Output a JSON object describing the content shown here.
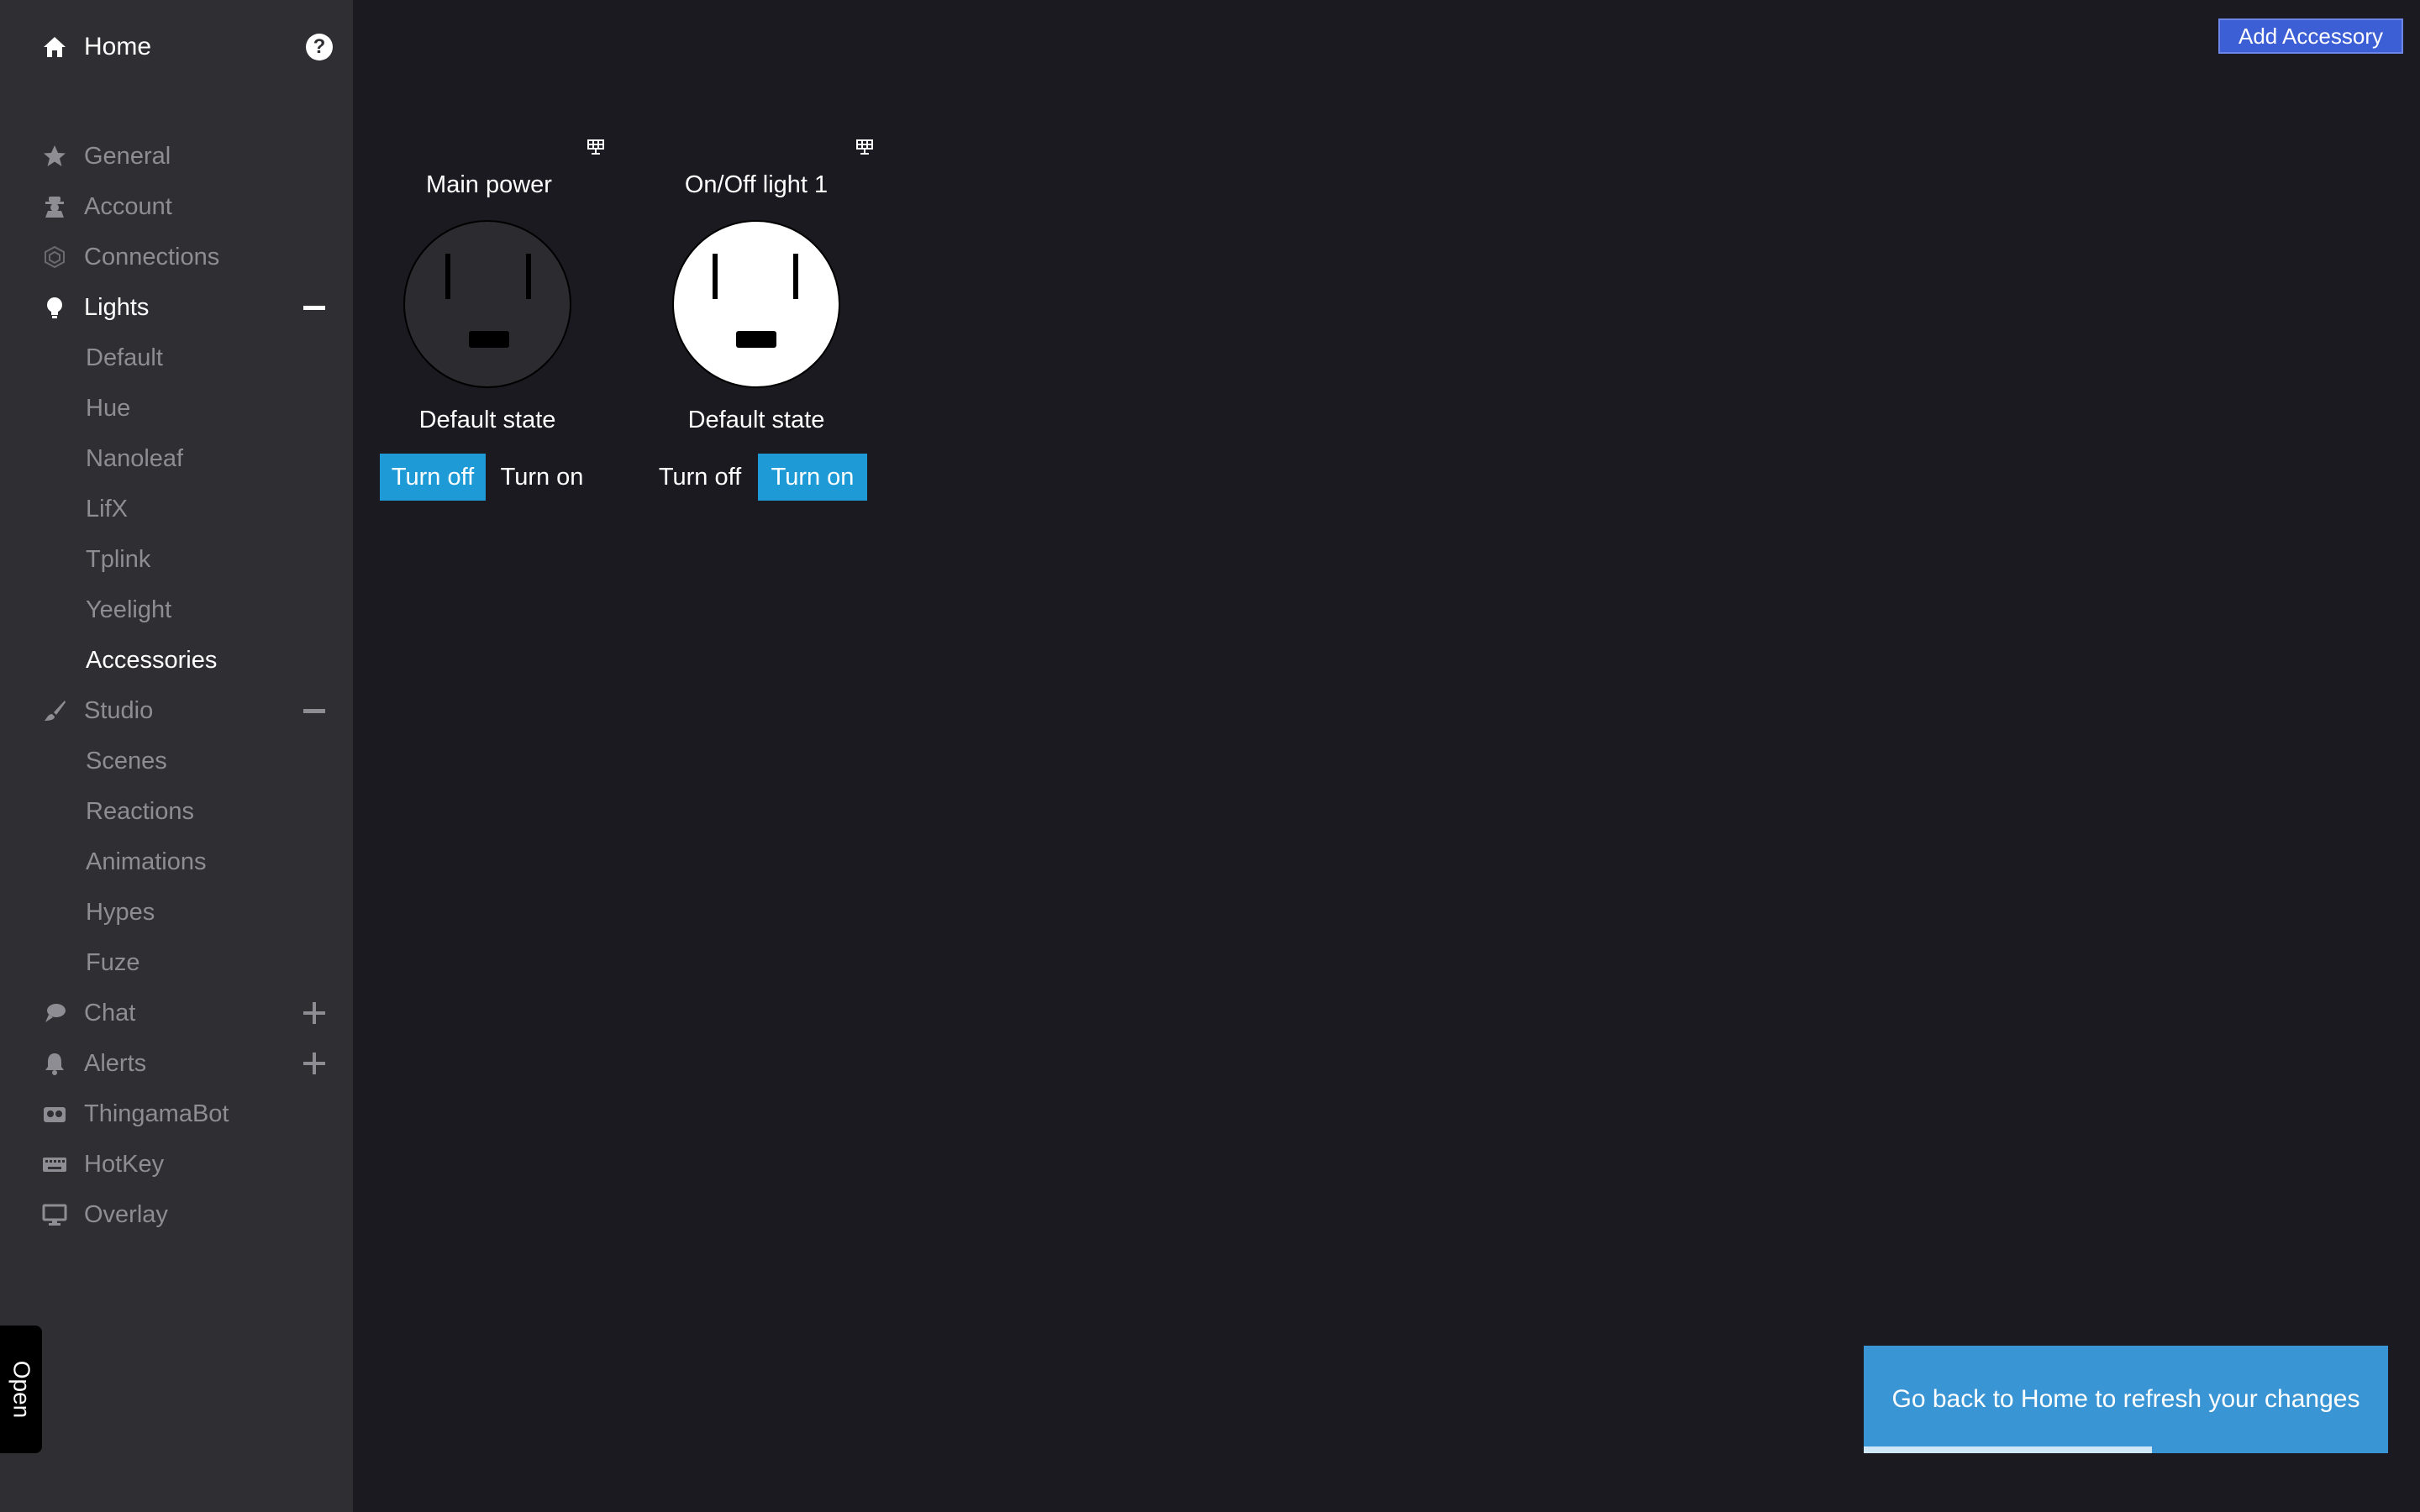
{
  "sidebar": {
    "home_label": "Home",
    "items": [
      {
        "label": "General",
        "icon": "star-icon"
      },
      {
        "label": "Account",
        "icon": "user-secret-icon"
      },
      {
        "label": "Connections",
        "icon": "network-icon"
      },
      {
        "label": "Lights",
        "icon": "lightbulb-icon",
        "toggle": "minus-icon"
      },
      {
        "label": "Studio",
        "icon": "brush-icon",
        "toggle": "minus-icon"
      },
      {
        "label": "Chat",
        "icon": "chat-icon",
        "toggle": "plus-icon"
      },
      {
        "label": "Alerts",
        "icon": "bell-icon",
        "toggle": "plus-icon"
      },
      {
        "label": "ThingamaBot",
        "icon": "robot-icon"
      },
      {
        "label": "HotKey",
        "icon": "keyboard-icon"
      },
      {
        "label": "Overlay",
        "icon": "monitor-icon"
      }
    ],
    "lights_sub": [
      "Default",
      "Hue",
      "Nanoleaf",
      "LifX",
      "Tplink",
      "Yeelight",
      "Accessories"
    ],
    "studio_sub": [
      "Scenes",
      "Reactions",
      "Animations",
      "Hypes",
      "Fuze"
    ],
    "open_tab_label": "Open"
  },
  "header": {
    "add_accessory_label": "Add Accessory"
  },
  "accessories": [
    {
      "name": "Main power",
      "default_label": "Default state",
      "turn_off": "Turn off",
      "turn_on": "Turn on",
      "state": "off"
    },
    {
      "name": "On/Off light 1",
      "default_label": "Default state",
      "turn_off": "Turn off",
      "turn_on": "Turn on",
      "state": "on"
    }
  ],
  "toast": {
    "message": "Go back to Home to refresh your changes",
    "progress": 0.55
  },
  "colors": {
    "sidebar_bg": "#2e2e33",
    "main_bg": "#1a1a20",
    "accent_blue": "#1e9ad6",
    "add_button": "#3d5fd6",
    "toast_bg": "#3a95d4",
    "muted_text": "#8d8d93"
  }
}
